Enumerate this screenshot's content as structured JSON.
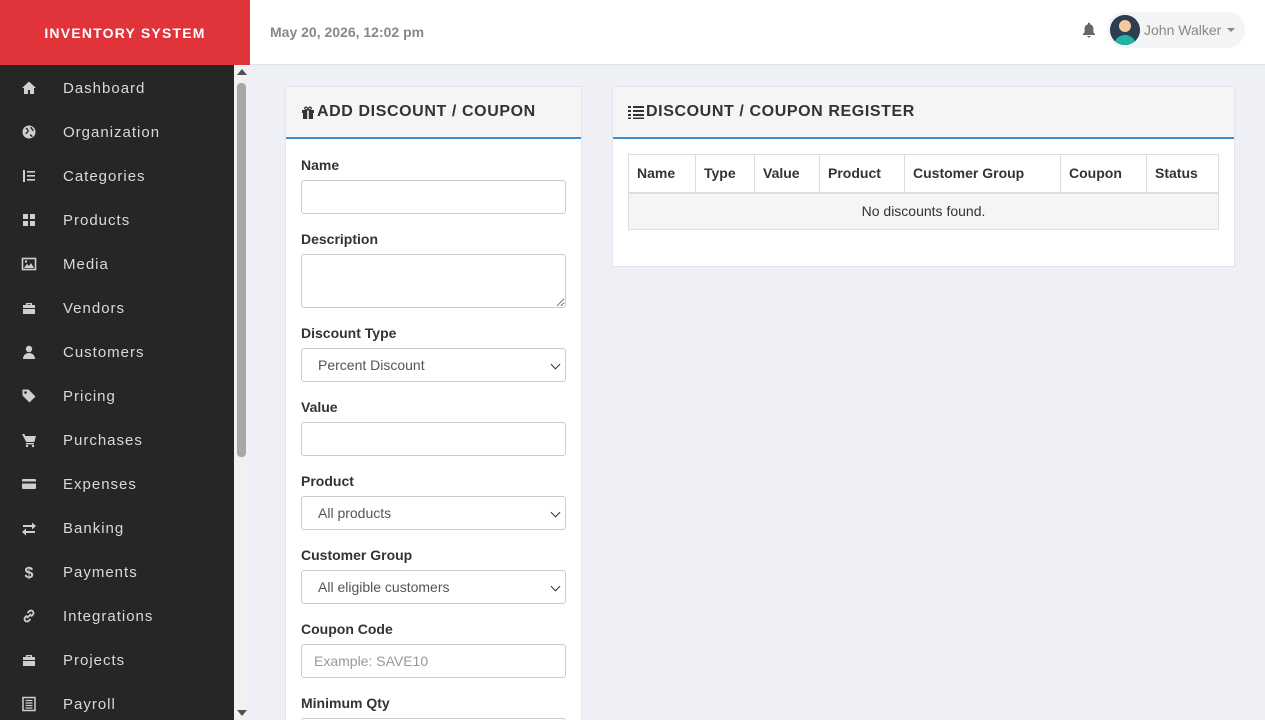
{
  "brand": "INVENTORY SYSTEM",
  "datetime": "May 20, 2026, 12:02 pm",
  "user": {
    "name": "John Walker"
  },
  "nav": [
    {
      "label": "Dashboard",
      "icon": "home-icon"
    },
    {
      "label": "Organization",
      "icon": "globe-icon"
    },
    {
      "label": "Categories",
      "icon": "indent-icon"
    },
    {
      "label": "Products",
      "icon": "grid-icon"
    },
    {
      "label": "Media",
      "icon": "image-icon"
    },
    {
      "label": "Vendors",
      "icon": "briefcase-icon"
    },
    {
      "label": "Customers",
      "icon": "user-icon"
    },
    {
      "label": "Pricing",
      "icon": "tag-icon"
    },
    {
      "label": "Purchases",
      "icon": "cart-icon"
    },
    {
      "label": "Expenses",
      "icon": "credit-card-icon"
    },
    {
      "label": "Banking",
      "icon": "transfer-icon"
    },
    {
      "label": "Payments",
      "icon": "dollar-icon"
    },
    {
      "label": "Integrations",
      "icon": "link-icon"
    },
    {
      "label": "Projects",
      "icon": "briefcase-icon"
    },
    {
      "label": "Payroll",
      "icon": "list-icon"
    }
  ],
  "add_panel": {
    "title": "ADD DISCOUNT / COUPON",
    "fields": {
      "name": {
        "label": "Name",
        "value": ""
      },
      "description": {
        "label": "Description",
        "value": ""
      },
      "discount_type": {
        "label": "Discount Type",
        "value": "Percent Discount"
      },
      "value": {
        "label": "Value",
        "value": ""
      },
      "product": {
        "label": "Product",
        "value": "All products"
      },
      "customer_group": {
        "label": "Customer Group",
        "value": "All eligible customers"
      },
      "coupon_code": {
        "label": "Coupon Code",
        "placeholder": "Example: SAVE10"
      },
      "min_qty": {
        "label": "Minimum Qty"
      }
    }
  },
  "register_panel": {
    "title": "DISCOUNT / COUPON REGISTER",
    "columns": [
      "Name",
      "Type",
      "Value",
      "Product",
      "Customer Group",
      "Coupon",
      "Status"
    ],
    "empty_message": "No discounts found."
  }
}
